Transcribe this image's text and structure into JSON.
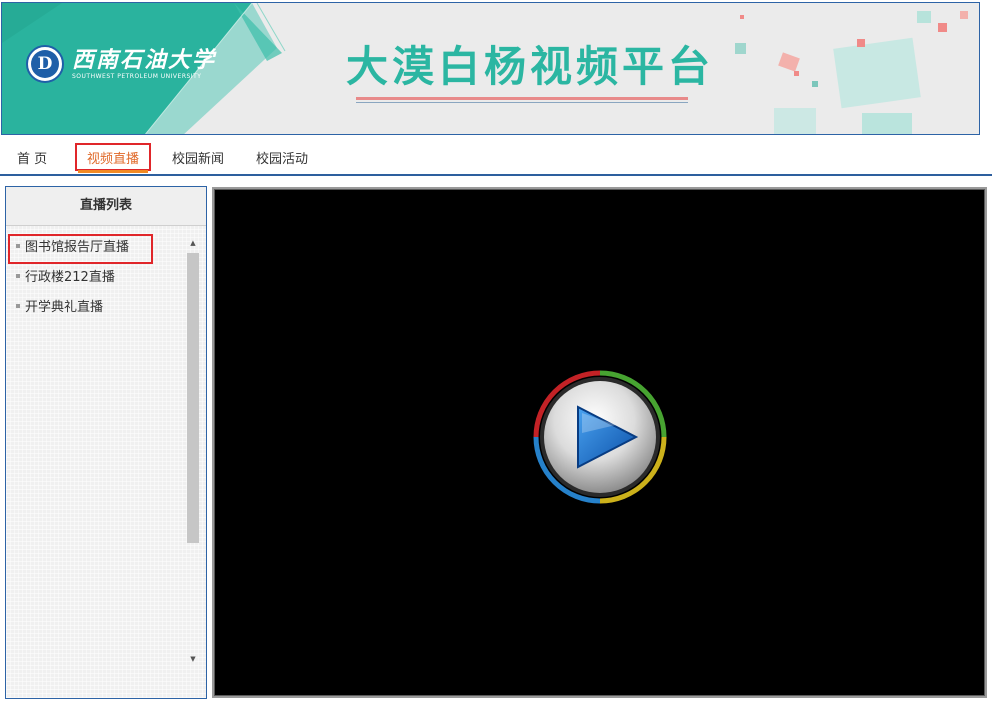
{
  "header": {
    "university_cn": "西南石油大学",
    "university_en": "SOUTHWEST PETROLEUM UNIVERSITY",
    "emblem_letter": "D",
    "platform_title": "大漠白杨视频平台",
    "colors": {
      "teal": "#2bb6a2",
      "banner_bg": "#ebebeb",
      "accent_pink": "#e88a8a"
    }
  },
  "nav": {
    "items": [
      {
        "label": "首 页",
        "active": false
      },
      {
        "label": "视频直播",
        "active": true
      },
      {
        "label": "校园新闻",
        "active": false
      },
      {
        "label": "校园活动",
        "active": false
      }
    ],
    "active_color": "#e06a2a",
    "rule_color": "#2d5f9e"
  },
  "sidebar": {
    "title": "直播列表",
    "items": [
      {
        "label": "图书馆报告厅直播",
        "selected": true
      },
      {
        "label": "行政楼212直播",
        "selected": false
      },
      {
        "label": "开学典礼直播",
        "selected": false
      }
    ],
    "scroll_up_icon": "▲",
    "scroll_down_icon": "▼"
  },
  "player": {
    "state": "stopped",
    "play_icon": "play-icon"
  }
}
